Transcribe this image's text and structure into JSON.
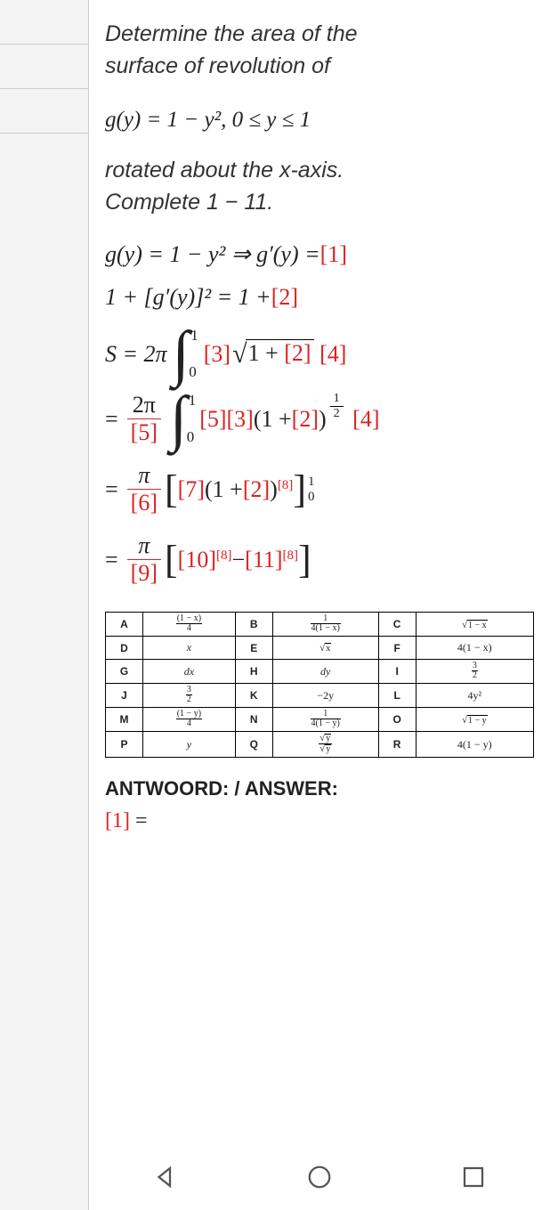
{
  "problem": {
    "line1": "Determine the area of the",
    "line2": "surface of revolution of",
    "eq_fn": "g(y) = 1 − y²,  0 ≤ y ≤ 1",
    "line3": "rotated about the x-axis.",
    "line4": "Complete 1 − 11."
  },
  "solution": {
    "step1_lhs": "g(y) = 1 − y² ⇒ g′(y) = ",
    "blank1": "[1]",
    "step2_lhs": "1 + [g′(y)]² = 1 + ",
    "blank2": "[2]",
    "S_label": "S = 2π",
    "int_top": "1",
    "int_bot": "0",
    "blank3": "[3]",
    "sqrt_inner_1": "1 + ",
    "blank2b": "[2]",
    "blank4": "[4]",
    "frac2_num": "2π",
    "blank5": "[5]",
    "blank5b": "[5]",
    "blank3b": "[3]",
    "blank2c": "[2]",
    "exp_half_num": "1",
    "exp_half_den": "2",
    "blank4b": "[4]",
    "pi_text": "π",
    "blank6": "[6]",
    "blank7": "[7]",
    "blank2d": "[2]",
    "blank8": "[8]",
    "eval_top": "1",
    "eval_bot": "0",
    "blank9": "[9]",
    "blank10": "[10]",
    "blank8b": "[8]",
    "minus": " − ",
    "blank11": "[11]",
    "blank8c": "[8]"
  },
  "options": {
    "rows": [
      {
        "k1": "A",
        "v1": "A",
        "k2": "B",
        "v2": "B",
        "k3": "C",
        "v3": "C"
      },
      {
        "k1": "D",
        "v1": "D",
        "k2": "E",
        "v2": "E",
        "k3": "F",
        "v3": "F"
      },
      {
        "k1": "G",
        "v1": "G",
        "k2": "H",
        "v2": "H",
        "k3": "I",
        "v3": "I"
      },
      {
        "k1": "J",
        "v1": "J",
        "k2": "K",
        "v2": "K",
        "k3": "L",
        "v3": "L"
      },
      {
        "k1": "M",
        "v1": "M",
        "k2": "N",
        "v2": "N",
        "k3": "O",
        "v3": "O"
      },
      {
        "k1": "P",
        "v1": "P",
        "k2": "Q",
        "v2": "Q",
        "k3": "R",
        "v3": "R"
      }
    ],
    "values": {
      "A_num": "(1 − x)",
      "A_den": "4",
      "B_num": "1",
      "B_den": "4(1 − x)",
      "C_sqrt": "1 − x",
      "D": "x",
      "E_sqrt": "x",
      "F": "4(1 − x)",
      "G": "dx",
      "H": "dy",
      "I_num": "3",
      "I_den": "2",
      "J_num": "3",
      "J_den": "2",
      "K": "−2y",
      "L": "4y²",
      "M_num": "(1 − y)",
      "M_den": "4",
      "N_num": "1",
      "N_den": "4(1 − y)",
      "O_sqrt": "1 − y",
      "P": "y",
      "Q_num_sqrt": "y",
      "R": "4(1 − y)"
    }
  },
  "answer": {
    "heading": "ANTWOORD: / ANSWER:",
    "line1_label": "[1]",
    "line1_eq": " ="
  },
  "nav": {
    "back": "back-icon",
    "home": "home-icon",
    "recent": "recent-icon"
  }
}
